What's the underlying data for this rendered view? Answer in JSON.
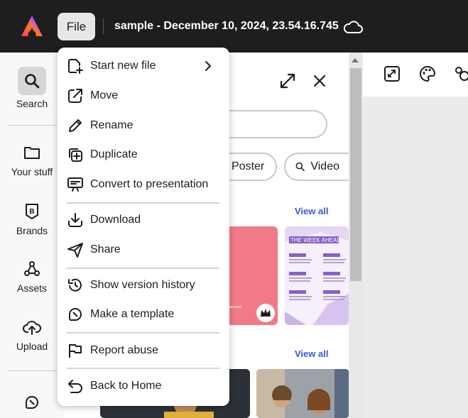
{
  "topbar": {
    "file_label": "File",
    "doc_title": "sample - December 10, 2024, 23.54.16.745"
  },
  "rail": {
    "items": [
      {
        "label": "Search",
        "icon": "search-icon"
      },
      {
        "label": "Your stuff",
        "icon": "folder-icon"
      },
      {
        "label": "Brands",
        "icon": "brand-icon"
      },
      {
        "label": "Assets",
        "icon": "assets-icon"
      },
      {
        "label": "Upload",
        "icon": "upload-icon"
      }
    ]
  },
  "panel": {
    "chips": [
      {
        "label": "Poster"
      },
      {
        "label": "Video"
      }
    ],
    "view_all_1": "View all",
    "view_all_2": "View all",
    "template_card": {
      "title": "THE WEEK AHEAD"
    }
  },
  "menu": {
    "items": [
      {
        "label": "Start new file",
        "icon": "new-file-icon",
        "has_submenu": true
      },
      {
        "label": "Move",
        "icon": "move-icon"
      },
      {
        "label": "Rename",
        "icon": "pencil-icon"
      },
      {
        "label": "Duplicate",
        "icon": "duplicate-icon"
      },
      {
        "label": "Convert to presentation",
        "icon": "presentation-icon"
      },
      {
        "label": "Download",
        "icon": "download-icon"
      },
      {
        "label": "Share",
        "icon": "share-icon"
      },
      {
        "label": "Show version history",
        "icon": "history-icon"
      },
      {
        "label": "Make a template",
        "icon": "template-icon"
      },
      {
        "label": "Report abuse",
        "icon": "flag-icon"
      },
      {
        "label": "Back to Home",
        "icon": "back-icon"
      }
    ]
  },
  "colors": {
    "topbar": "#1e1e1e",
    "accent_link": "#3b57d9",
    "template_purple": "#8a5fc7",
    "template_pink": "#f27a86"
  }
}
